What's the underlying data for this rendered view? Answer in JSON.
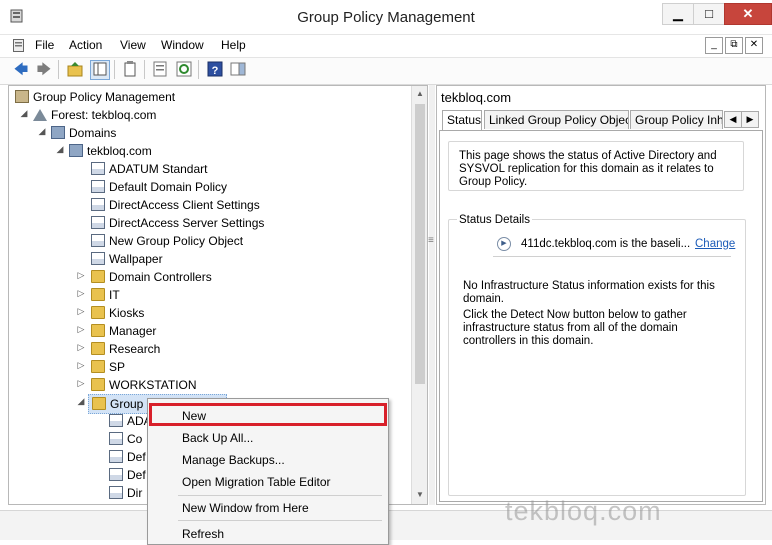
{
  "window": {
    "title": "Group Policy Management",
    "minimize": "▁",
    "restore": "□",
    "close": "✕"
  },
  "menu": {
    "items": [
      "File",
      "Action",
      "View",
      "Window",
      "Help"
    ]
  },
  "tree": {
    "root": "Group Policy Management",
    "forest": "Forest: tekbloq.com",
    "domains": "Domains",
    "domain": "tekbloq.com",
    "gpos": [
      "ADATUM Standart",
      "Default Domain Policy",
      "DirectAccess Client Settings",
      "DirectAccess Server Settings",
      "New Group Policy Object",
      "Wallpaper"
    ],
    "ous": [
      "Domain Controllers",
      "IT",
      "Kiosks",
      "Manager",
      "Research",
      "SP",
      "WORKSTATION"
    ],
    "gpo_container": "Group Policy Objects",
    "gpo_children": [
      "ADA",
      "Co",
      "Def",
      "Def",
      "Dir"
    ]
  },
  "right": {
    "heading": "tekbloq.com",
    "tabs": [
      "Status",
      "Linked Group Policy Objects",
      "Group Policy Inher"
    ],
    "info": "This page shows the status of Active Directory and SYSVOL replication for this domain as it relates to Group Policy.",
    "status_details": {
      "label": "Status Details",
      "dc_line": "411dc.tekbloq.com  is the baseli...",
      "change": "Change",
      "no_info": "No Infrastructure Status information exists for this domain.",
      "detect": "Click the Detect Now button below to gather infrastructure status from all of the domain controllers in this domain."
    }
  },
  "context_menu": {
    "items": [
      "New",
      "Back Up All...",
      "Manage Backups...",
      "Open Migration Table Editor",
      "New Window from Here",
      "Refresh"
    ],
    "highlight_color": "#d8202a"
  },
  "watermark": "tekbloq.com"
}
